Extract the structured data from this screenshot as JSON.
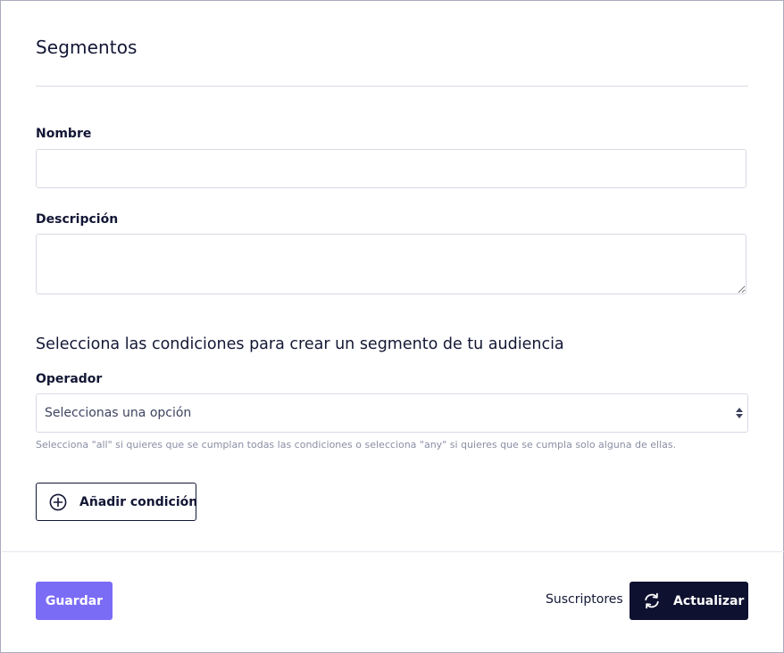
{
  "header": {
    "title": "Segmentos"
  },
  "form": {
    "name_label": "Nombre",
    "name_value": "",
    "description_label": "Descripción",
    "description_value": "",
    "conditions_title": "Selecciona las condiciones para crear un segmento de tu audiencia",
    "operator_label": "Operador",
    "operator_selected": "Seleccionas una opción",
    "operator_help": "Selecciona \"all\" si quieres que se cumplan todas las condiciones o selecciona \"any\" si quieres que se cumpla solo alguna de ellas.",
    "add_condition_label": "Añadir condición",
    "add_condition_icon": "plus-circle-icon"
  },
  "footer": {
    "save_label": "Guardar",
    "subscribers_label": "Suscriptores",
    "update_label": "Actualizar",
    "update_icon": "refresh-icon"
  },
  "colors": {
    "primary_button": "#7b6cf6",
    "dark_button": "#0e1230",
    "text": "#131735",
    "border": "#d9dbe4"
  }
}
